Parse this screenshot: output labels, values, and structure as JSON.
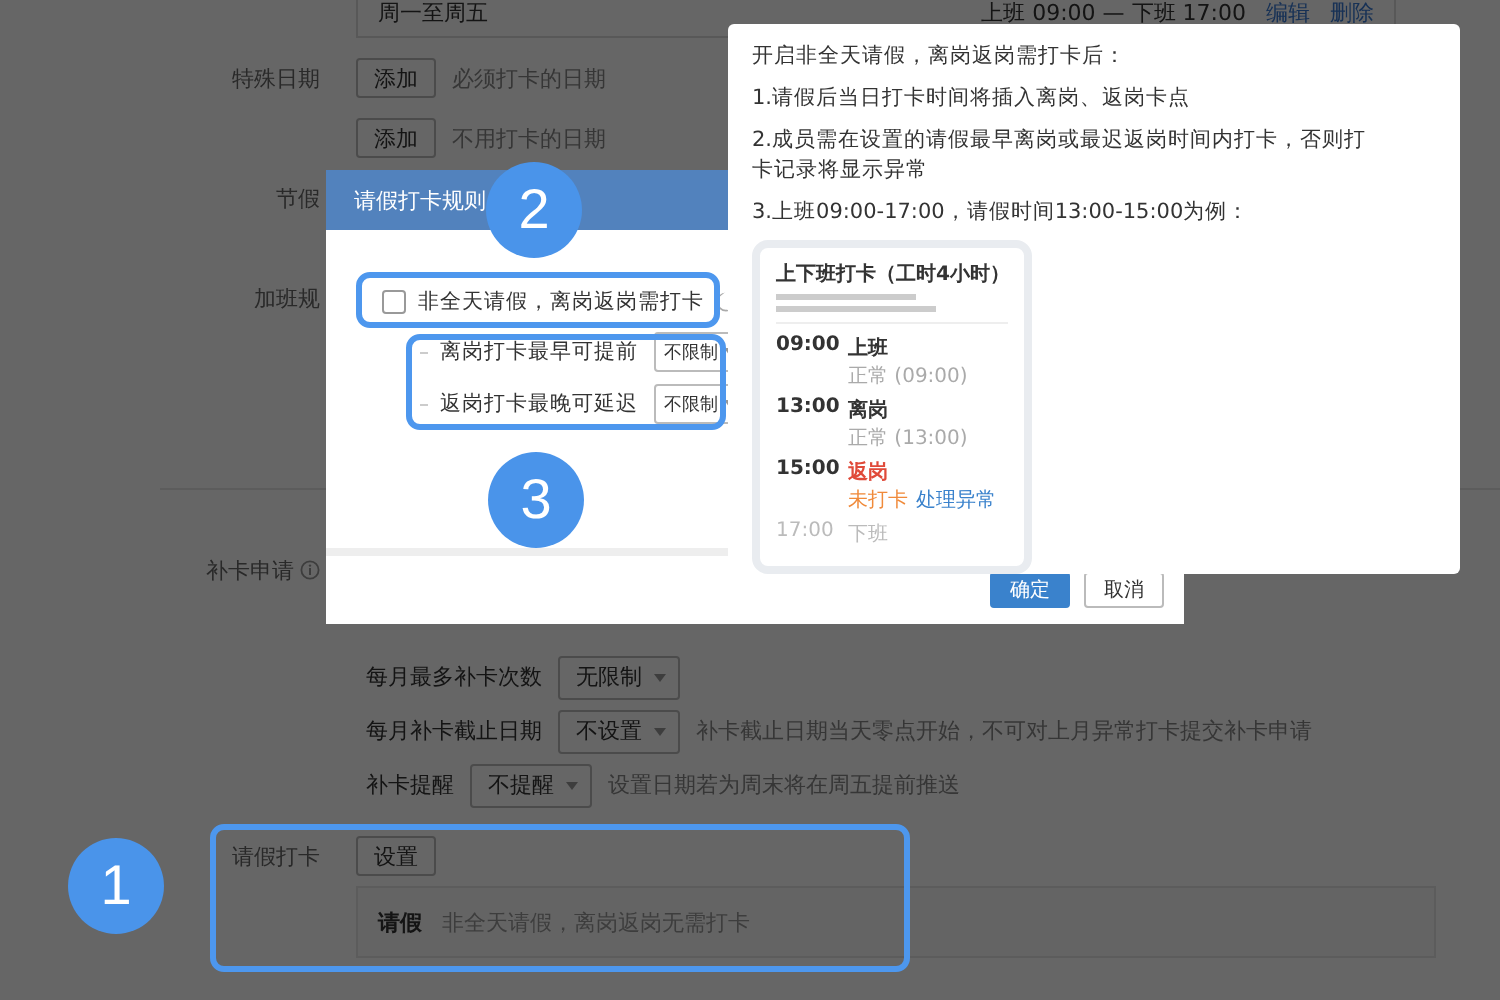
{
  "schedule": {
    "days": "周一至周五",
    "hours": "上班 09:00 — 下班 17:00",
    "actions": [
      "编辑",
      "删除"
    ]
  },
  "special_dates": {
    "label": "特殊日期",
    "rows": [
      {
        "button": "添加",
        "hint": "必须打卡的日期"
      },
      {
        "button": "添加",
        "hint": "不用打卡的日期"
      }
    ]
  },
  "holiday_label": "节假",
  "overtime_label": "加班规",
  "makeup": {
    "label": "补卡申请",
    "settings": [
      {
        "label": "每月最多补卡次数",
        "value": "无限制"
      },
      {
        "label": "每月补卡截止日期",
        "value": "不设置",
        "note": "补卡截止日期当天零点开始，不可对上月异常打卡提交补卡申请"
      },
      {
        "label": "补卡提醒",
        "value": "不提醒",
        "note": "设置日期若为周末将在周五提前推送"
      }
    ]
  },
  "leave": {
    "label": "请假打卡",
    "button": "设置",
    "summary_title": "请假",
    "summary_text": "非全天请假，离岗返岗无需打卡"
  },
  "dialog": {
    "title": "请假打卡规则",
    "checkbox": {
      "label": "非全天请假，离岗返岗需打卡",
      "checked": false
    },
    "options": [
      {
        "label": "离岗打卡最早可提前",
        "value": "不限制"
      },
      {
        "label": "返岗打卡最晚可延迟",
        "value": "不限制"
      }
    ],
    "buttons": [
      {
        "label": "确定",
        "kind": "primary"
      },
      {
        "label": "取消",
        "kind": "default"
      }
    ]
  },
  "popover": {
    "lines": [
      "开启非全天请假，离岗返岗需打卡后：",
      "1.请假后当日打卡时间将插入离岗、返岗卡点",
      "2.成员需在设置的请假最早离岗或最迟返岗时间内打卡，否则打卡记录将显示异常",
      "3.上班09:00-17:00，请假时间13:00-15:00为例："
    ],
    "example": {
      "title": "上下班打卡（工时4小时）",
      "entries": [
        {
          "time": "09:00",
          "label": "上班",
          "kind": "normal",
          "status": "正常 (09:00)"
        },
        {
          "time": "13:00",
          "label": "离岗",
          "kind": "normal",
          "status": "正常 (13:00)"
        },
        {
          "time": "15:00",
          "label": "返岗",
          "kind": "missed",
          "status": "未打卡",
          "action": "处理异常"
        },
        {
          "time": "17:00",
          "label": "下班",
          "kind": "upcoming"
        }
      ]
    }
  },
  "callouts": [
    {
      "number": "2"
    },
    {
      "number": "3"
    },
    {
      "number": "1"
    }
  ]
}
